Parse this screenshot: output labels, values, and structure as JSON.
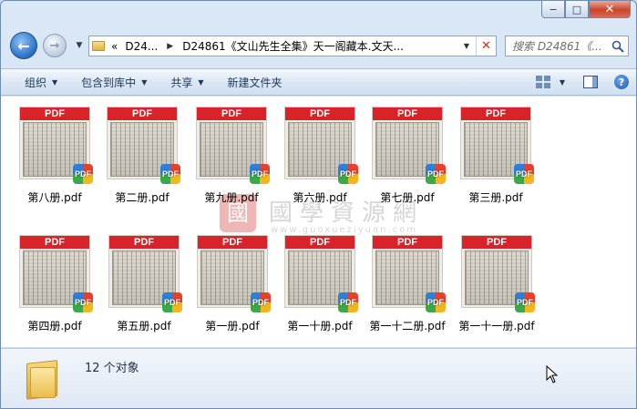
{
  "window": {
    "caption": {
      "minimize": "−",
      "maximize": "□",
      "close": "✕"
    }
  },
  "nav": {
    "back_icon": "back-arrow-icon",
    "forward_icon": "forward-arrow-icon",
    "address": {
      "prefix": "«",
      "crumbs": [
        "D24...",
        "D24861《文山先生全集》天一阁藏本.文天..."
      ]
    },
    "search_placeholder": "搜索 D24861《..."
  },
  "toolbar": {
    "organize": "组织",
    "include_in_library": "包含到库中",
    "share": "共享",
    "new_folder": "新建文件夹"
  },
  "files": [
    {
      "name": "第八册.pdf"
    },
    {
      "name": "第二册.pdf"
    },
    {
      "name": "第九册.pdf"
    },
    {
      "name": "第六册.pdf"
    },
    {
      "name": "第七册.pdf"
    },
    {
      "name": "第三册.pdf"
    },
    {
      "name": "第四册.pdf"
    },
    {
      "name": "第五册.pdf"
    },
    {
      "name": "第一册.pdf"
    },
    {
      "name": "第一十册.pdf"
    },
    {
      "name": "第一十二册.pdf"
    },
    {
      "name": "第一十一册.pdf"
    }
  ],
  "thumb_label": "PDF",
  "badge_label": "PDF",
  "watermark": {
    "logo": "國",
    "title": "國學資源網",
    "url": "www.guoxueziyuan.com"
  },
  "status": {
    "count": "12 个对象"
  },
  "colors": {
    "pdf_red": "#d8232a",
    "toolbar_text": "#1e395b",
    "close_red": "#c8462c"
  }
}
